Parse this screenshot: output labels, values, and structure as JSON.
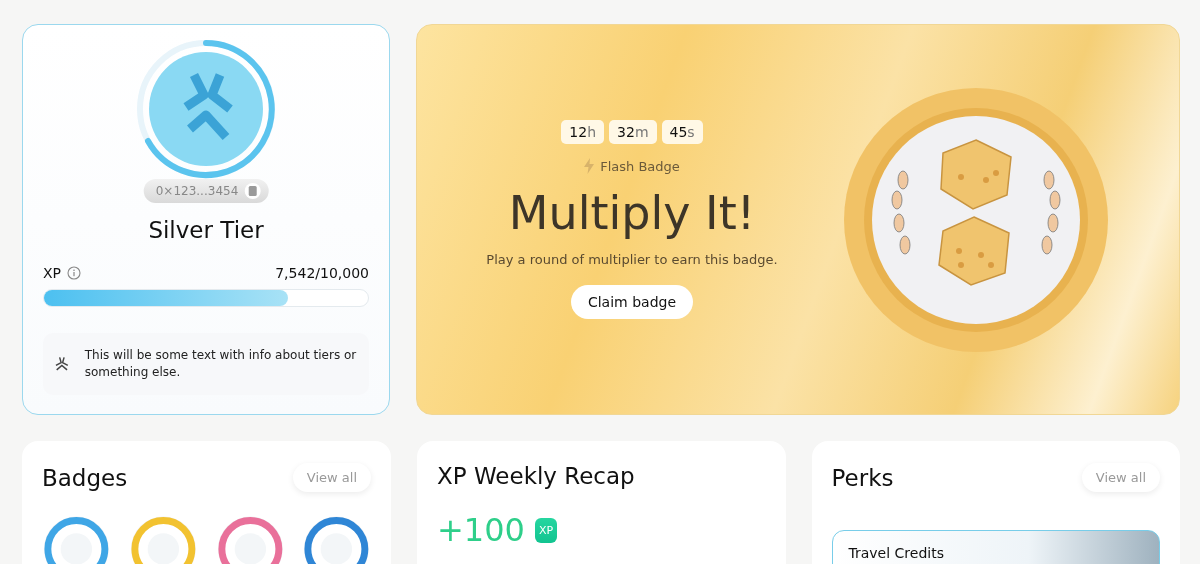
{
  "tier_card": {
    "wallet": "0×123...3454",
    "title": "Silver Tier",
    "xp_label": "XP",
    "xp_value": "7,542/10,000",
    "level": 0.7542,
    "info": "This will be some text with info about tiers or something else."
  },
  "flash_card": {
    "timer": [
      {
        "value": "12",
        "unit": "h"
      },
      {
        "value": "32",
        "unit": "m"
      },
      {
        "value": "45",
        "unit": "s"
      }
    ],
    "tag": "Flash Badge",
    "title": "Multiply It!",
    "description": "Play a round of multiplier to earn this badge.",
    "button": "Claim badge"
  },
  "badges": {
    "title": "Badges",
    "button": "View all",
    "items": [
      {
        "color": "#3fa6e6"
      },
      {
        "color": "#f2c230"
      },
      {
        "color": "#e9709a"
      },
      {
        "color": "#2f86d6"
      }
    ]
  },
  "recap": {
    "title": "XP Weekly Recap",
    "amount": "+100",
    "unit": "XP"
  },
  "perks": {
    "title": "Perks",
    "button": "View all",
    "items": [
      {
        "title": "Travel Credits"
      }
    ]
  }
}
